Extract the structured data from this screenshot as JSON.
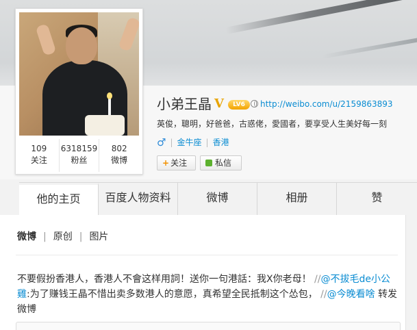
{
  "profile": {
    "name": "小弟王晶",
    "level_badge": "LV6",
    "url": "http://weibo.com/u/2159863893",
    "bio": "英俊，聰明，好爸爸，古惑佬，愛國者，要享受人生美好每一刻",
    "gender_symbol": "♂",
    "zodiac": "金牛座",
    "location": "香港",
    "follow_button": "关注",
    "message_button": "私信"
  },
  "stats": [
    {
      "value": "109",
      "label": "关注"
    },
    {
      "value": "6318159",
      "label": "粉丝"
    },
    {
      "value": "802",
      "label": "微博"
    }
  ],
  "tabs": [
    {
      "label": "他的主页",
      "active": true
    },
    {
      "label": "百度人物资料",
      "active": false
    },
    {
      "label": "微博",
      "active": false
    },
    {
      "label": "相册",
      "active": false
    },
    {
      "label": "赞",
      "active": false
    }
  ],
  "filter": {
    "active": "微博",
    "items": [
      "原创",
      "图片"
    ]
  },
  "post": {
    "text1": "不要假扮香港人，香港人不會这样用詞！送你一句港話：我X你老母！",
    "slash1": "//",
    "mention1": "@不拔毛de小公雞",
    "text2": ":为了赚钱王晶不惜出卖多数港人的意愿，真希望全民抵制这个怂包，",
    "slash2": "//",
    "mention2": "@今晚看啥",
    "text3": " 转发微博"
  },
  "colors": {
    "link": "#0a8cd2",
    "badge": "#f3a300",
    "verified": "#e8a400"
  }
}
